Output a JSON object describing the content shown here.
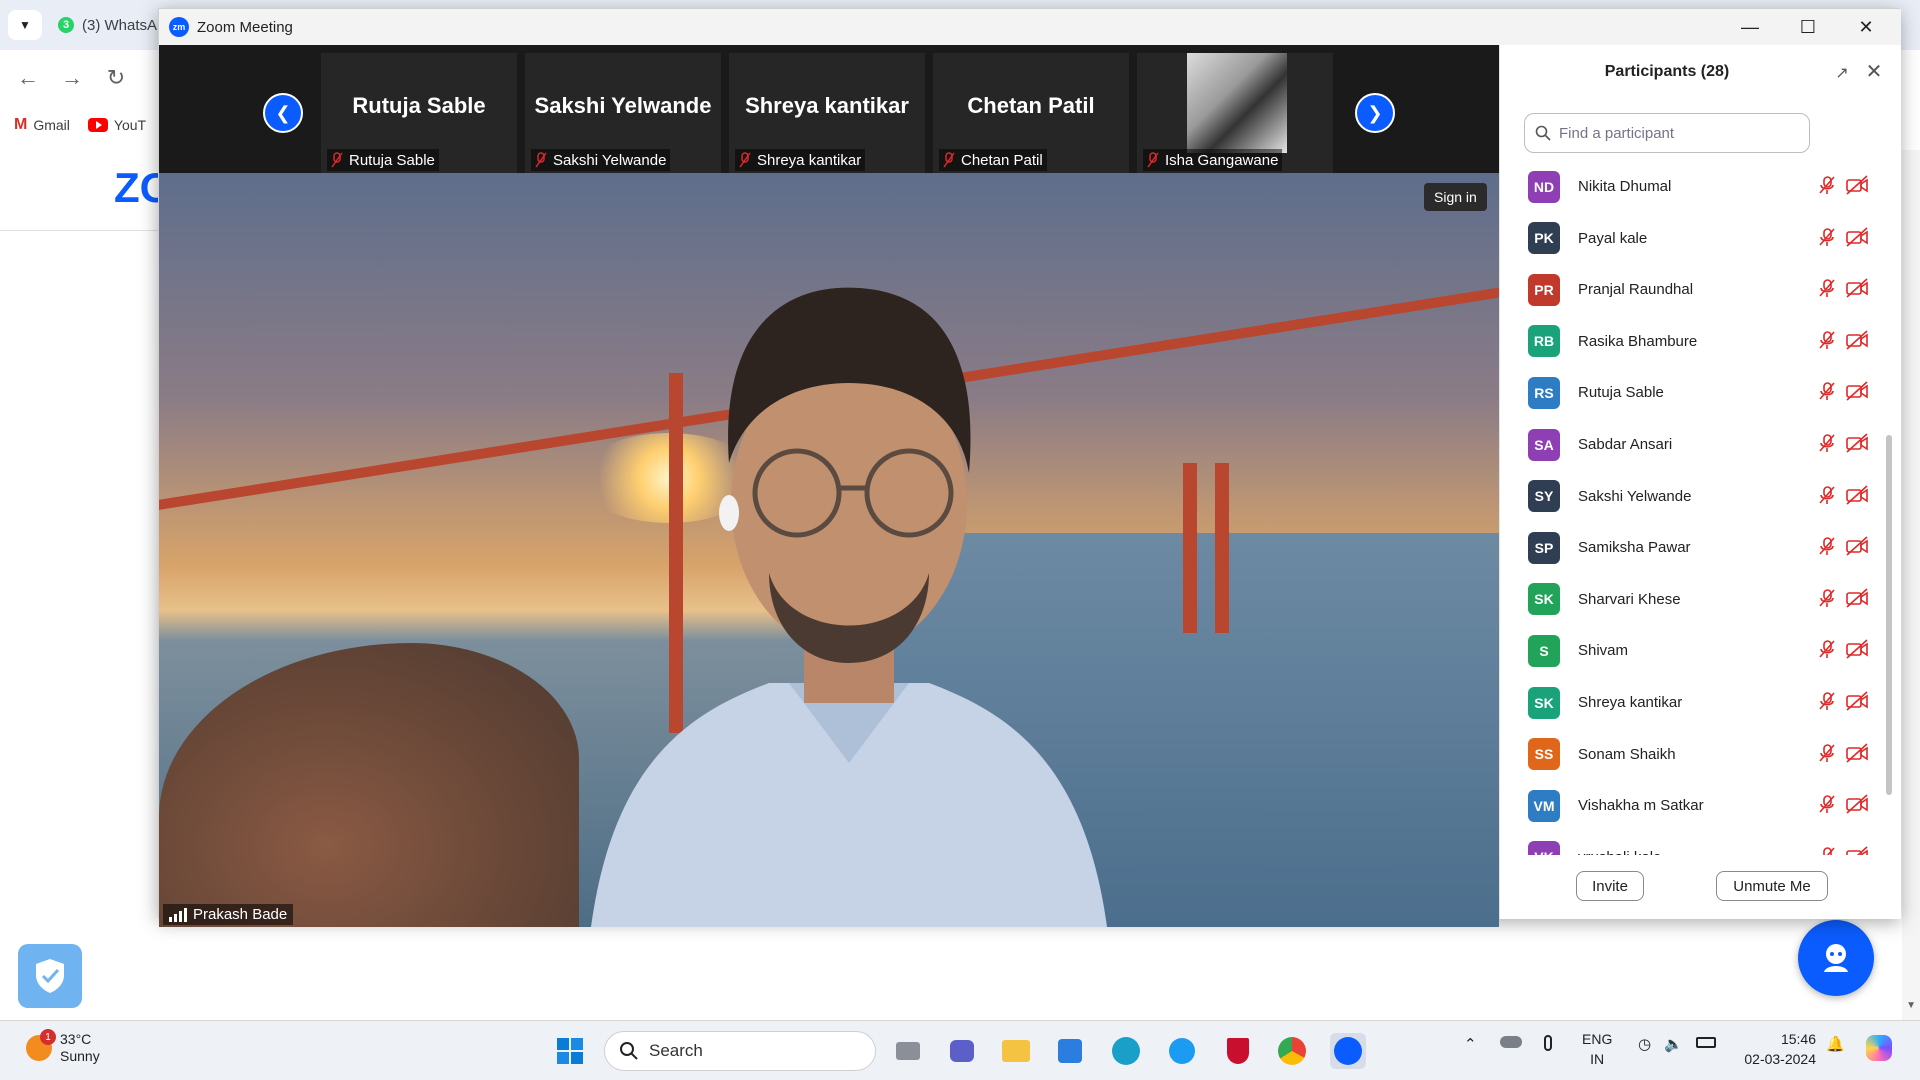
{
  "browser": {
    "tab_count_badge": "3",
    "tab_title": "(3) WhatsA",
    "bookmarks": [
      {
        "label": "Gmail"
      },
      {
        "label": "YouT"
      }
    ],
    "page_logo": "ZO"
  },
  "zoom": {
    "window_title": "Zoom Meeting",
    "badge": "zm",
    "gallery": [
      {
        "display_name": "Rutuja Sable",
        "label": "Rutuja Sable"
      },
      {
        "display_name": "Sakshi Yelwande",
        "label": "Sakshi Yelwande"
      },
      {
        "display_name": "Shreya kantikar",
        "label": "Shreya kantikar"
      },
      {
        "display_name": "Chetan Patil",
        "label": "Chetan Patil"
      },
      {
        "display_name": "",
        "label": "Isha Gangawane"
      }
    ],
    "main_video": {
      "speaker": "Prakash Bade",
      "sign_in_label": "Sign in"
    },
    "participants_panel": {
      "title": "Participants (28)",
      "search_placeholder": "Find a participant",
      "participants": [
        {
          "initials": "ND",
          "name": "Nikita Dhumal",
          "color": "#8e3fb4"
        },
        {
          "initials": "PK",
          "name": "Payal kale",
          "color": "#2f3e52"
        },
        {
          "initials": "PR",
          "name": "Pranjal Raundhal",
          "color": "#c0392b"
        },
        {
          "initials": "RB",
          "name": "Rasika Bhambure",
          "color": "#1aa37a"
        },
        {
          "initials": "RS",
          "name": "Rutuja Sable",
          "color": "#2e7cc4"
        },
        {
          "initials": "SA",
          "name": "Sabdar Ansari",
          "color": "#8e3fb4"
        },
        {
          "initials": "SY",
          "name": "Sakshi Yelwande",
          "color": "#2f3e52"
        },
        {
          "initials": "SP",
          "name": "Samiksha Pawar",
          "color": "#2f3e52"
        },
        {
          "initials": "SK",
          "name": "Sharvari Khese",
          "color": "#22a35a"
        },
        {
          "initials": "S",
          "name": "Shivam",
          "color": "#22a35a"
        },
        {
          "initials": "SK",
          "name": "Shreya kantikar",
          "color": "#1aa37a"
        },
        {
          "initials": "SS",
          "name": "Sonam Shaikh",
          "color": "#e0661a"
        },
        {
          "initials": "VM",
          "name": "Vishakha m Satkar",
          "color": "#2e7cc4"
        },
        {
          "initials": "VK",
          "name": "vrushali kale",
          "color": "#8e3fb4"
        }
      ],
      "invite_label": "Invite",
      "unmute_label": "Unmute Me"
    }
  },
  "taskbar": {
    "weather_badge": "1",
    "temperature": "33°C",
    "condition": "Sunny",
    "search_label": "Search",
    "lang_top": "ENG",
    "lang_bottom": "IN",
    "time": "15:46",
    "date": "02-03-2024"
  },
  "colors": {
    "zoom_blue": "#0b5cff",
    "mute_red": "#e02828"
  }
}
